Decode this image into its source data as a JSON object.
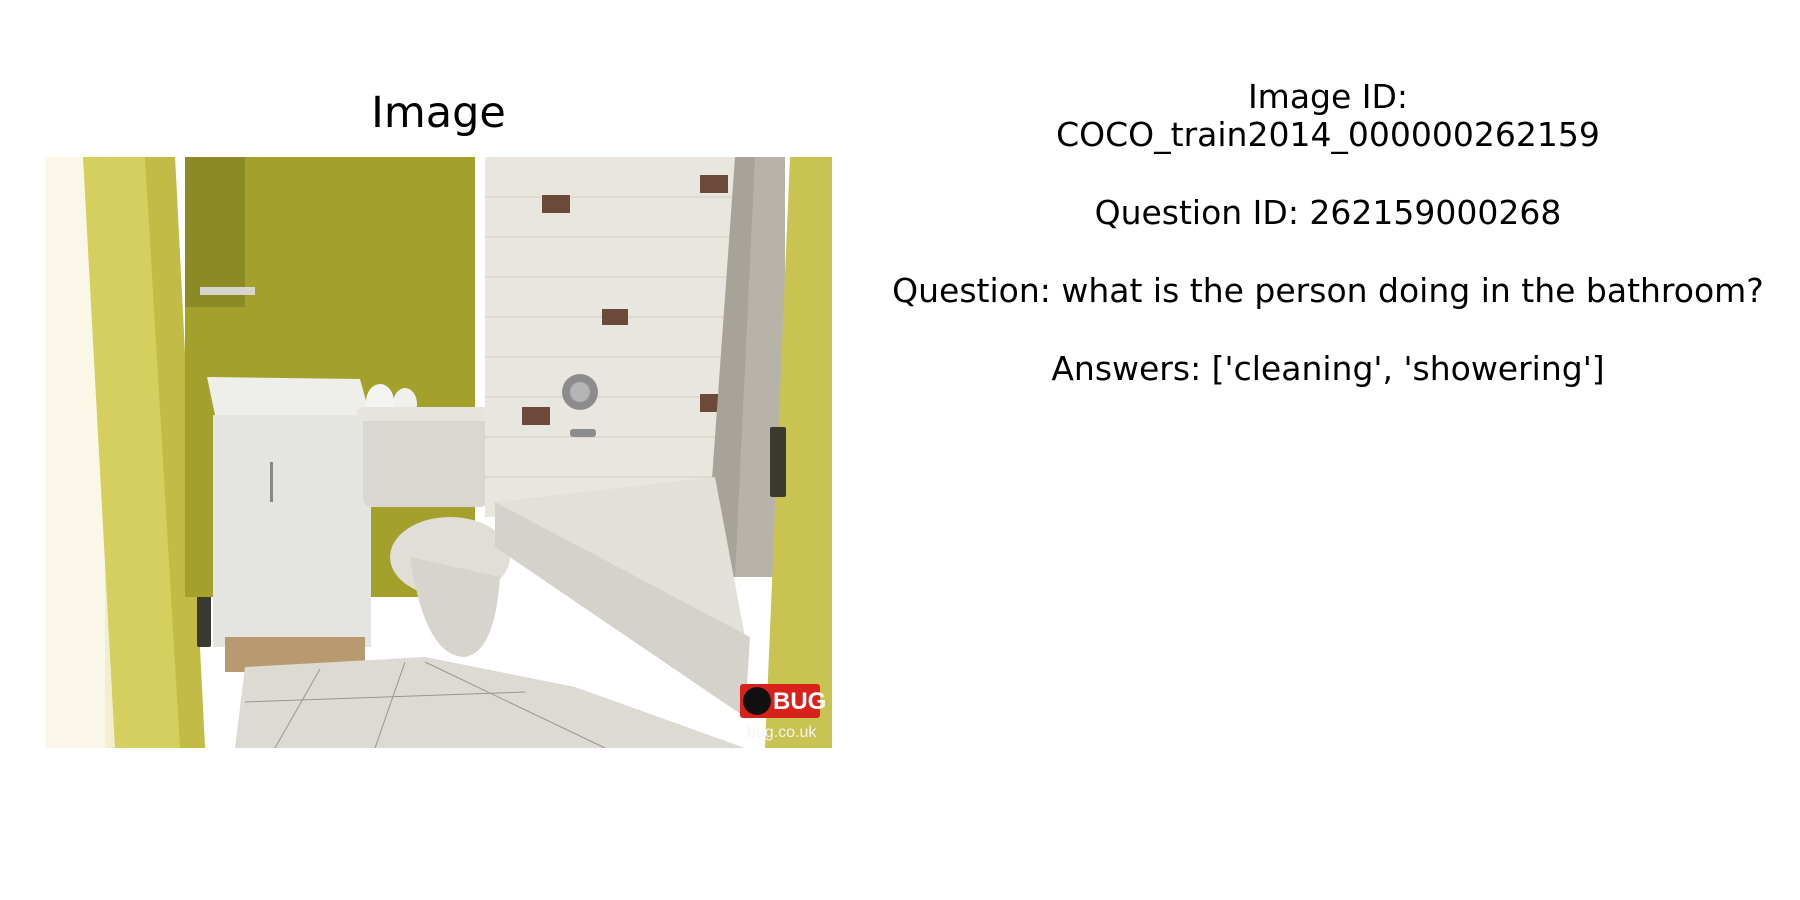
{
  "title": "Image",
  "info": {
    "image_id_text": "Image ID:\nCOCO_train2014_000000262159",
    "question_id_text": "Question ID: 262159000268",
    "question_text": "Question: what is the person doing in the bathroom?",
    "answers_text": "Answers: ['cleaning', 'showering']"
  },
  "photo": {
    "description_icon": "bathroom-photo",
    "watermark_brand": "BUG",
    "watermark_url": "bug.co.uk"
  }
}
